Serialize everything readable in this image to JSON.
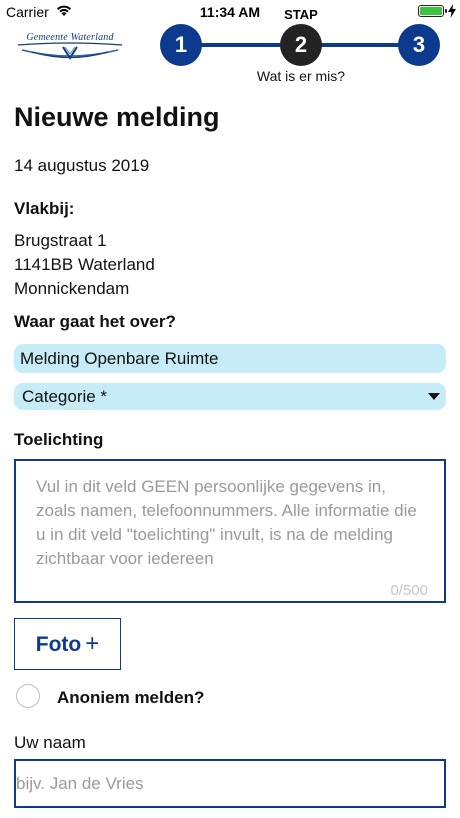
{
  "status_bar": {
    "carrier": "Carrier",
    "time": "11:34 AM",
    "battery_color": "#3dc43d"
  },
  "header": {
    "logo_text": "Gemeente Waterland",
    "stepper": {
      "label": "STAP",
      "steps": [
        "1",
        "2",
        "3"
      ],
      "active_step": 2,
      "caption": "Wat is er mis?"
    }
  },
  "form": {
    "title": "Nieuwe melding",
    "date": "14 augustus 2019",
    "near_label": "Vlakbij:",
    "address": [
      "Brugstraat 1",
      "1141BB Waterland",
      "Monnickendam"
    ],
    "about_label": "Waar gaat het over?",
    "subject_value": "Melding Openbare Ruimte",
    "category_value": "Categorie *",
    "explanation_label": "Toelichting",
    "explanation_placeholder": "Vul in dit veld GEEN persoonlijke gegevens in, zoals namen, telefoonnummers. Alle informatie die u in dit veld \"toelichting\" invult, is na de melding zichtbaar voor iedereen",
    "explanation_counter": "0/500",
    "photo_button": "Foto",
    "photo_plus": "+",
    "anonymous_label": "Anoniem melden?",
    "name_label": "Uw naam",
    "name_placeholder": "bijv. Jan de Vries"
  },
  "colors": {
    "accent": "#0d3a8e",
    "active_step": "#232323",
    "field_fill": "#c6ecf8"
  }
}
